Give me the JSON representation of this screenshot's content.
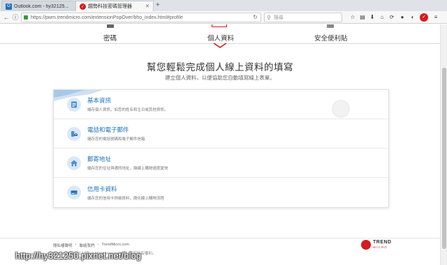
{
  "browser": {
    "tabs": [
      {
        "label": "Outlook.com - hy32125...",
        "icon": "outlook-icon",
        "active": false
      },
      {
        "label": "趨勢科技密碼管理器",
        "icon": "trendmicro-icon",
        "active": true
      }
    ],
    "new_tab_label": "+",
    "url_secure_icon": "lock-icon",
    "url": "https://pwm.trendmicro.com/extensionPopOver/bho_index.html#profile",
    "search_placeholder": "搜尋",
    "toolbar_icons": [
      "star-icon",
      "reading-list-icon",
      "download-icon",
      "home-icon",
      "sync-icon",
      "chat-icon",
      "theme-icon",
      "trendmicro-ext-icon",
      "menu-icon"
    ]
  },
  "top_tabs": [
    {
      "label": "密碼",
      "active": false
    },
    {
      "label": "個人資料",
      "active": true
    },
    {
      "label": "安全便利貼",
      "active": false
    }
  ],
  "heading": "幫您輕鬆完成個人線上資料的填寫",
  "subheading": "建立個人資料，以便協助您自動填寫線上表單。",
  "options": [
    {
      "title": "基本資訊",
      "desc": "儲存個人資訊，如您的姓名和生日或其他資訊。",
      "icon": "id-card-icon"
    },
    {
      "title": "電話和電子郵件",
      "desc": "儲存您的電話號碼和電子郵件信箱",
      "icon": "phone-email-icon"
    },
    {
      "title": "郵寄地址",
      "desc": "儲存您的住址與通訊地址，讓線上購物速度變快",
      "icon": "house-icon"
    },
    {
      "title": "信用卡資料",
      "desc": "儲存您的信用卡詳細資料，簡化線上購物流程",
      "icon": "credit-card-icon"
    }
  ],
  "footer": {
    "links": [
      "隱私權聲明",
      "聯絡我們",
      "TrendMicro.com"
    ],
    "copyright": "Copyright © 2017 Trend Micro Incorporated. 保留所有權利。",
    "logo_top": "TREND",
    "logo_bottom": "MICRO"
  },
  "watermark": "http://hy321250.pixnet.net/blog",
  "colors": {
    "accent": "#d71920",
    "link": "#1a73b8",
    "icon_bg": "#dbe9f7"
  }
}
